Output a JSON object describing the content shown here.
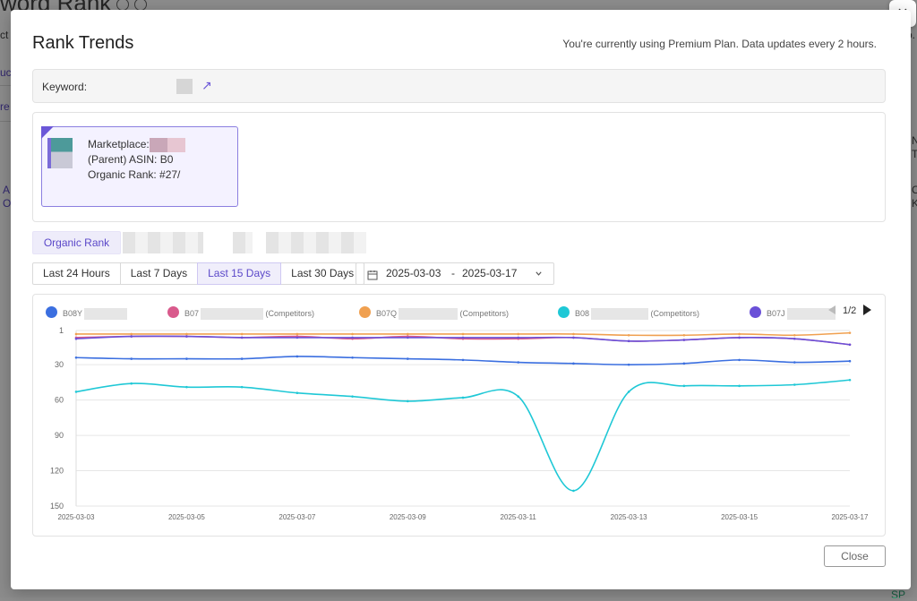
{
  "background": {
    "title": "word Rank",
    "fragments": [
      "ct",
      "uc",
      "re",
      "A",
      "O",
      "o.",
      "N",
      "T",
      "C",
      "K",
      "SP"
    ]
  },
  "modal": {
    "title": "Rank Trends",
    "plan_notice": "You're currently using Premium Plan. Data updates every 2 hours.",
    "keyword_label": "Keyword:",
    "asin_card": {
      "marketplace_label": "Marketplace:",
      "asin_label": "(Parent) ASIN: B0",
      "rank_label": "Organic Rank: #27/"
    },
    "rank_tab": "Organic Rank",
    "ranges": [
      "Last 24 Hours",
      "Last 7 Days",
      "Last 15 Days",
      "Last 30 Days"
    ],
    "active_range": "Last 15 Days",
    "date_start": "2025-03-03",
    "date_sep": "-",
    "date_end": "2025-03-17",
    "legend_page": "1/2",
    "close_label": "Close",
    "x_icon": "×"
  },
  "icons": {
    "external-link": "↗",
    "calendar": "📅",
    "chevron": "⌄",
    "next": "▶",
    "prev": "◀"
  },
  "chart_data": {
    "type": "line",
    "x": [
      "2025-03-03",
      "2025-03-04",
      "2025-03-05",
      "2025-03-06",
      "2025-03-07",
      "2025-03-08",
      "2025-03-09",
      "2025-03-10",
      "2025-03-11",
      "2025-03-12",
      "2025-03-13",
      "2025-03-14",
      "2025-03-15",
      "2025-03-16",
      "2025-03-17"
    ],
    "x_tick_labels": [
      "2025-03-03",
      "2025-03-05",
      "2025-03-07",
      "2025-03-09",
      "2025-03-11",
      "2025-03-13",
      "2025-03-15",
      "2025-03-17"
    ],
    "y_ticks": [
      1,
      30,
      60,
      90,
      120,
      150
    ],
    "ylim": [
      1,
      150
    ],
    "y_inverted": true,
    "grid": true,
    "legend_position": "top",
    "series": [
      {
        "name": "B08Y",
        "suffix": "",
        "color": "#3b6fe0",
        "values": [
          24,
          25,
          25,
          25,
          23,
          24,
          25,
          26,
          28,
          29,
          30,
          29,
          26,
          28,
          27
        ]
      },
      {
        "name": "B07",
        "suffix": "(Competitors)",
        "color": "#d95a8c",
        "values": [
          7,
          6,
          6,
          7,
          6,
          8,
          6,
          8,
          8,
          7,
          10,
          9,
          7,
          8,
          13
        ]
      },
      {
        "name": "B07Q",
        "suffix": "(Competitors)",
        "color": "#f0a050",
        "values": [
          4,
          4,
          4,
          4,
          4,
          4,
          4,
          4,
          4,
          4,
          5,
          5,
          4,
          5,
          3
        ]
      },
      {
        "name": "B08",
        "suffix": "(Competitors)",
        "color": "#1fc8d6",
        "values": [
          53,
          46,
          49,
          49,
          54,
          57,
          61,
          58,
          57,
          137,
          53,
          48,
          48,
          47,
          43
        ]
      },
      {
        "name": "B07J",
        "suffix": "",
        "color": "#6a50d8",
        "values": [
          8,
          6,
          6,
          7,
          7,
          7,
          7,
          7,
          7,
          7,
          10,
          9,
          7,
          8,
          13
        ]
      }
    ]
  }
}
